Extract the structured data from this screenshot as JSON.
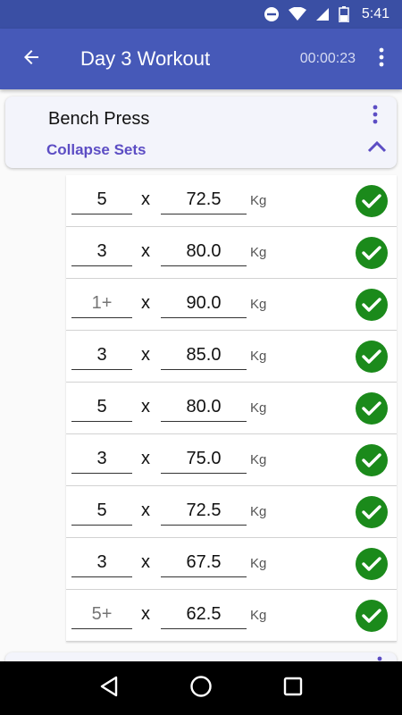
{
  "status_bar": {
    "time": "5:41"
  },
  "app_bar": {
    "title": "Day 3 Workout",
    "timer": "00:00:23"
  },
  "exercise": {
    "name": "Bench Press",
    "collapse_label": "Collapse Sets",
    "sets": [
      {
        "reps": "5",
        "reps_placeholder": false,
        "weight": "72.5",
        "unit": "Kg",
        "times": "x"
      },
      {
        "reps": "3",
        "reps_placeholder": false,
        "weight": "80.0",
        "unit": "Kg",
        "times": "x"
      },
      {
        "reps": "1+",
        "reps_placeholder": true,
        "weight": "90.0",
        "unit": "Kg",
        "times": "x"
      },
      {
        "reps": "3",
        "reps_placeholder": false,
        "weight": "85.0",
        "unit": "Kg",
        "times": "x"
      },
      {
        "reps": "5",
        "reps_placeholder": false,
        "weight": "80.0",
        "unit": "Kg",
        "times": "x"
      },
      {
        "reps": "3",
        "reps_placeholder": false,
        "weight": "75.0",
        "unit": "Kg",
        "times": "x"
      },
      {
        "reps": "5",
        "reps_placeholder": false,
        "weight": "72.5",
        "unit": "Kg",
        "times": "x"
      },
      {
        "reps": "3",
        "reps_placeholder": false,
        "weight": "67.5",
        "unit": "Kg",
        "times": "x"
      },
      {
        "reps": "5+",
        "reps_placeholder": true,
        "weight": "62.5",
        "unit": "Kg",
        "times": "x"
      }
    ]
  },
  "icons": {
    "back": "arrow-back-icon",
    "menu": "more-vert-icon",
    "collapse": "chevron-up-icon",
    "done": "check-circle-icon",
    "nav_back": "nav-back-icon",
    "nav_home": "nav-home-icon",
    "nav_recents": "nav-recents-icon"
  },
  "colors": {
    "primary": "#4659b8",
    "primary_dark": "#3a4fa4",
    "accent": "#5c4dc4",
    "check": "#1b8a1b"
  }
}
